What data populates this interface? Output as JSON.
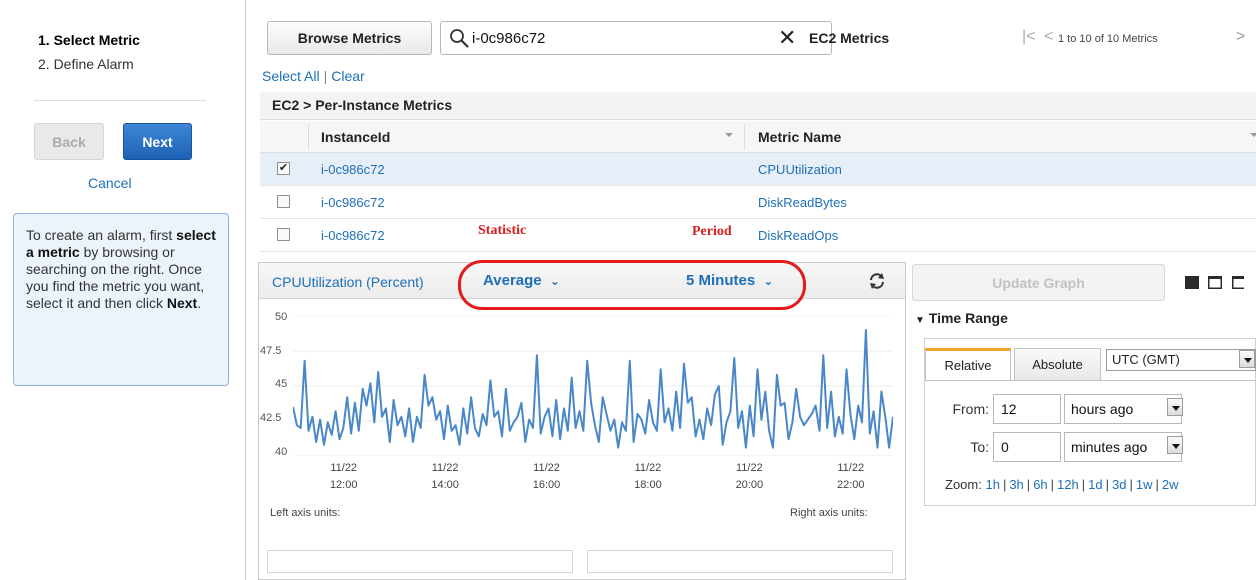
{
  "wizard": {
    "steps": [
      "1. Select Metric",
      "2. Define Alarm"
    ],
    "back_label": "Back",
    "next_label": "Next",
    "cancel_label": "Cancel",
    "help_prefix": "To create an alarm, first ",
    "help_bold": "select a metric",
    "help_middle": " by browsing or searching on the right. Once you find the metric you want, select it and then click ",
    "help_bold2": "Next",
    "help_suffix": "."
  },
  "toolbar": {
    "browse_label": "Browse Metrics",
    "search_value": "i-0c986c72",
    "clear_icon": "close-icon",
    "namespace_label": "EC2 Metrics",
    "pager_text": "1 to 10 of 10 Metrics"
  },
  "selection": {
    "select_all": "Select All",
    "clear": "Clear",
    "separator": "|"
  },
  "table": {
    "breadcrumb": "EC2 > Per-Instance Metrics",
    "columns": [
      "InstanceId",
      "Metric Name"
    ],
    "rows": [
      {
        "checked": true,
        "instance": "i-0c986c72",
        "metric": "CPUUtilization"
      },
      {
        "checked": false,
        "instance": "i-0c986c72",
        "metric": "DiskReadBytes"
      },
      {
        "checked": false,
        "instance": "i-0c986c72",
        "metric": "DiskReadOps"
      }
    ]
  },
  "annotations": {
    "statistic": "Statistic",
    "period": "Period",
    "highlight_color": "#e21b1b"
  },
  "graph": {
    "title": "CPUUtilization (Percent)",
    "statistic": "Average",
    "period": "5 Minutes",
    "left_units": "Left axis units:",
    "right_units": "Right axis units:"
  },
  "chart_data": {
    "type": "line",
    "title": "CPUUtilization (Percent)",
    "ylim": [
      40,
      50
    ],
    "y_ticks": [
      "50",
      "47.5",
      "45",
      "42.5",
      "40"
    ],
    "x_ticks": [
      {
        "date": "11/22",
        "time": "12:00"
      },
      {
        "date": "11/22",
        "time": "14:00"
      },
      {
        "date": "11/22",
        "time": "16:00"
      },
      {
        "date": "11/22",
        "time": "18:00"
      },
      {
        "date": "11/22",
        "time": "20:00"
      },
      {
        "date": "11/22",
        "time": "22:00"
      }
    ],
    "x_start": "11:00",
    "x_end": "22:50",
    "line_color": "#4a87c8",
    "series": [
      {
        "values": [
          43.5,
          42.2,
          42.0,
          46.8,
          41.8,
          42.8,
          41.0,
          42.6,
          40.8,
          42.4,
          41.5,
          43.2,
          41.2,
          42.0,
          44.2,
          41.6,
          43.8,
          41.8,
          44.8,
          43.6,
          45.2,
          42.4,
          46.0,
          42.8,
          43.4,
          41.0,
          44.0,
          42.2,
          42.8,
          41.4,
          43.4,
          41.0,
          42.8,
          42.0,
          45.8,
          43.6,
          44.2,
          42.6,
          43.2,
          41.2,
          43.6,
          41.8,
          42.2,
          40.8,
          43.4,
          41.6,
          44.2,
          42.0,
          41.4,
          43.0,
          42.2,
          45.4,
          42.8,
          43.2,
          41.4,
          44.8,
          41.8,
          42.4,
          42.8,
          43.8,
          41.0,
          42.6,
          42.0,
          47.2,
          41.6,
          42.8,
          43.4,
          41.4,
          44.0,
          41.2,
          43.4,
          41.8,
          45.6,
          42.0,
          43.2,
          41.8,
          46.8,
          43.8,
          42.2,
          41.0,
          44.2,
          43.0,
          41.8,
          42.6,
          40.6,
          42.4,
          41.8,
          46.8,
          41.0,
          43.0,
          42.6,
          41.6,
          44.0,
          42.4,
          41.8,
          46.2,
          42.4,
          43.4,
          41.8,
          44.6,
          42.0,
          46.6,
          43.8,
          44.2,
          41.4,
          42.6,
          41.2,
          43.4,
          42.2,
          44.4,
          45.0,
          40.8,
          42.4,
          43.2,
          47.0,
          42.0,
          43.2,
          40.6,
          43.6,
          41.4,
          46.2,
          42.6,
          44.6,
          41.8,
          40.6,
          45.8,
          43.6,
          43.8,
          41.2,
          42.4,
          44.8,
          42.8,
          42.2,
          42.6,
          43.0,
          43.6,
          41.8,
          47.2,
          42.0,
          44.6,
          41.4,
          42.8,
          41.6,
          46.2,
          43.0,
          41.2,
          43.6,
          42.4,
          49.0,
          41.6,
          43.2,
          40.6,
          44.6,
          42.8,
          40.6,
          42.8
        ]
      }
    ],
    "grid": true
  },
  "time_range": {
    "label": "Time Range",
    "update_label": "Update Graph",
    "tabs": [
      "Relative",
      "Absolute"
    ],
    "timezone": "UTC (GMT)",
    "from_label": "From:",
    "from_value": "12",
    "from_unit": "hours ago",
    "to_label": "To:",
    "to_value": "0",
    "to_unit": "minutes ago",
    "zoom_label": "Zoom:",
    "zoom_options": [
      "1h",
      "3h",
      "6h",
      "12h",
      "1d",
      "3d",
      "1w",
      "2w"
    ]
  }
}
